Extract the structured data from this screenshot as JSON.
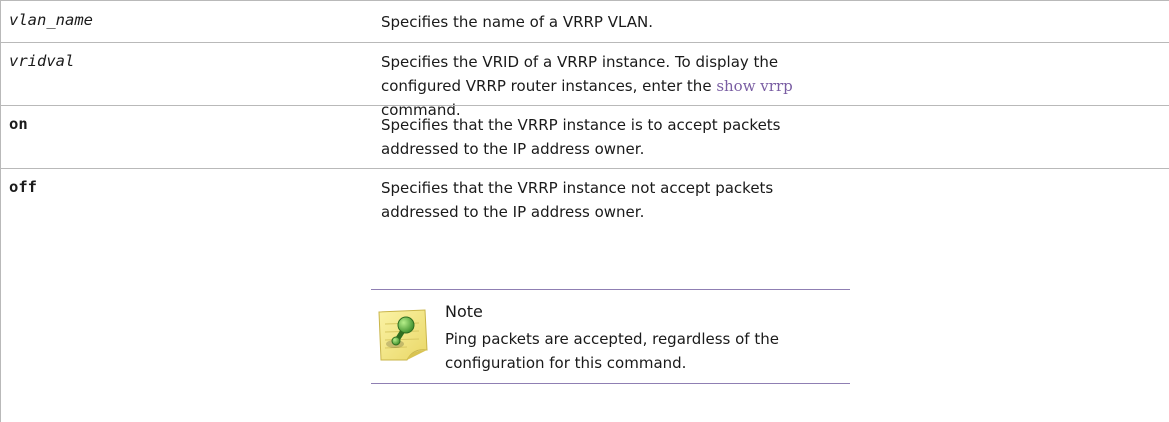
{
  "rows": [
    {
      "term": "vlan_name",
      "description": "Specifies the name of a VRRP VLAN."
    },
    {
      "term": "vridval",
      "description_before": "Specifies the VRID of a VRRP instance. To display the configured VRRP router instances, enter the ",
      "command": "show vrrp",
      "description_after": " command."
    },
    {
      "term": "on",
      "description": "Specifies that the VRRP instance is to accept packets addressed to the IP address owner."
    },
    {
      "term": "off",
      "description": "Specifies that the VRRP instance not accept packets addressed to the IP address owner."
    }
  ],
  "note": {
    "icon": "note-icon",
    "title": "Note",
    "body": "Ping packets are accepted, regardless of the configuration for this command."
  },
  "colors": {
    "border": "#b9b9b9",
    "command_link": "#7a5ea3",
    "note_rule": "#8f7fb3"
  }
}
